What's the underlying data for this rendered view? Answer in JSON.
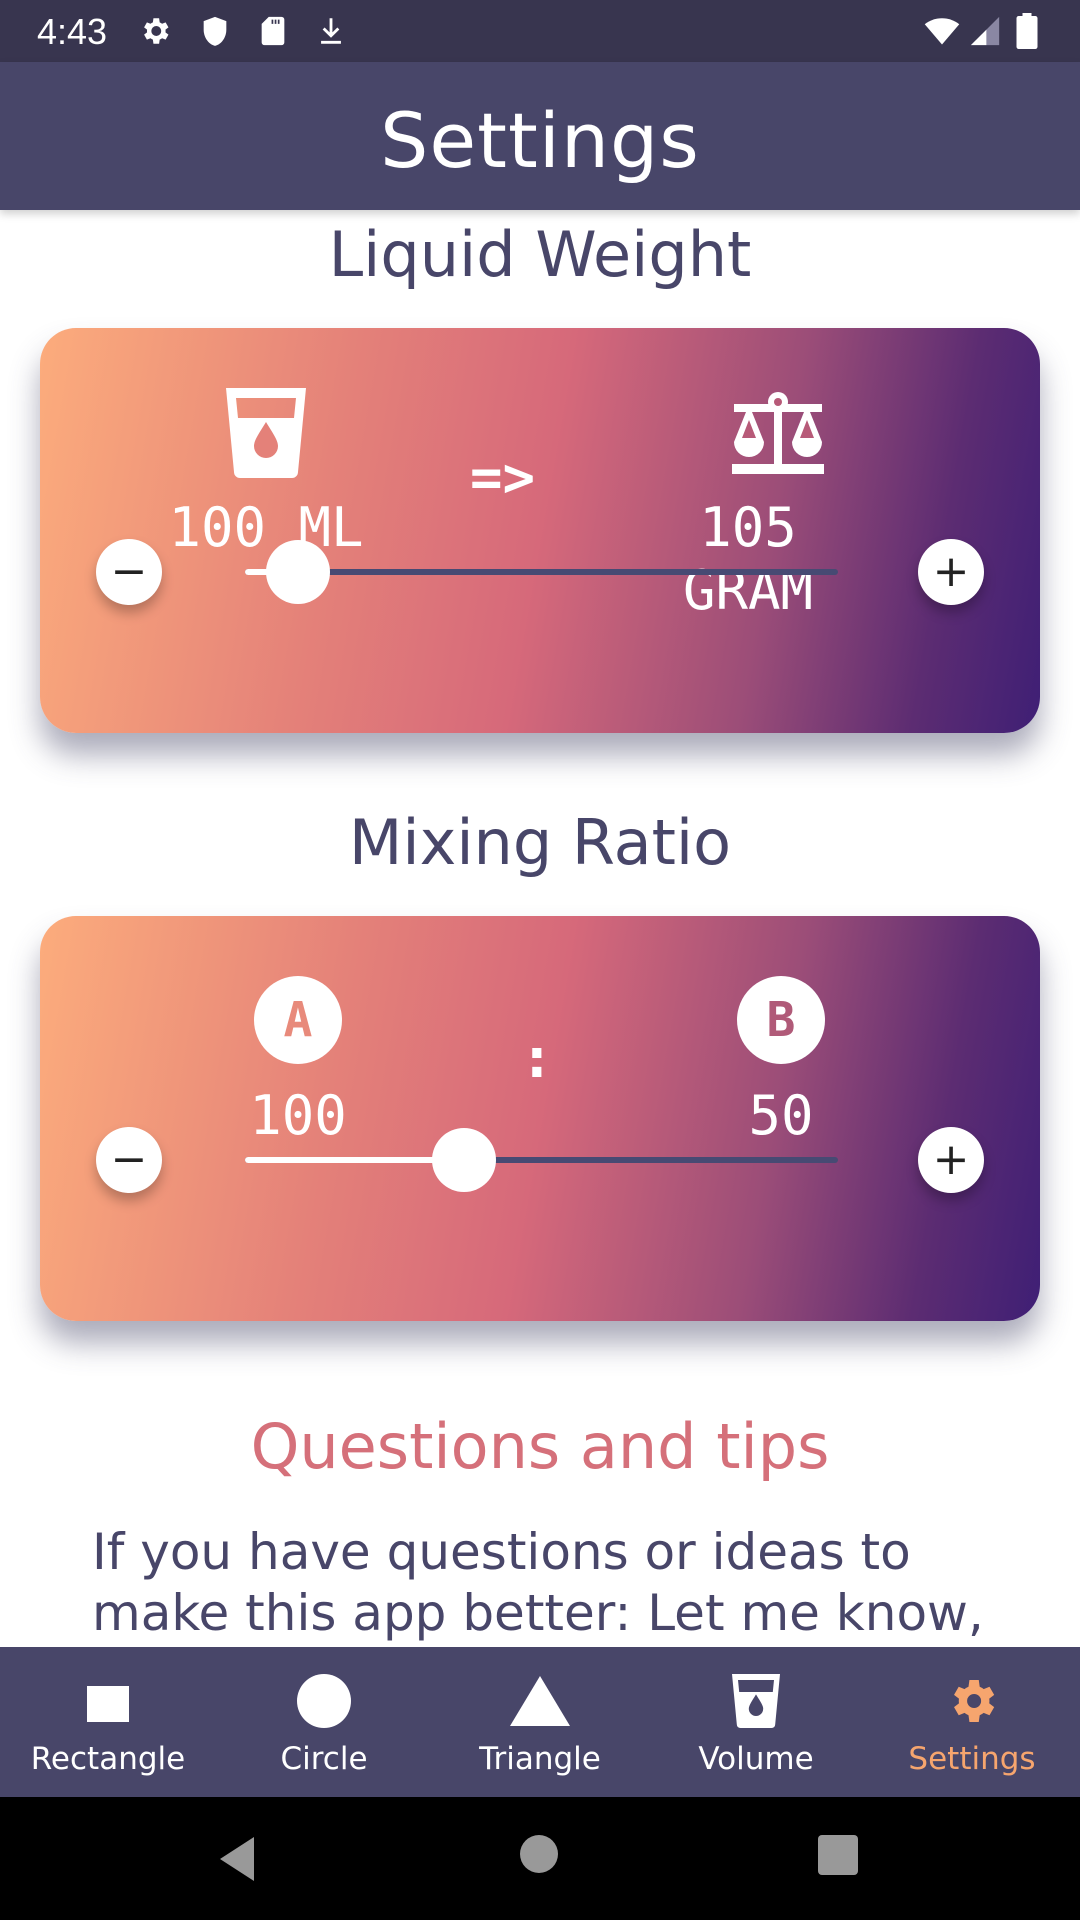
{
  "status_bar": {
    "time": "4:43",
    "left_icons": [
      "gear-icon",
      "shield-icon",
      "sd-card-icon",
      "download-icon"
    ],
    "right_icons": [
      "wifi-icon",
      "cell-signal-icon",
      "battery-icon"
    ]
  },
  "app_bar": {
    "title": "Settings"
  },
  "liquid_weight": {
    "title": "Liquid Weight",
    "from_icon": "glass-water-icon",
    "from_value": "100 ML",
    "arrow": "=>",
    "to_icon": "scale-icon",
    "to_value": "105 GRAM",
    "decrease_label": "−",
    "increase_label": "+",
    "slider_fraction": 0.09
  },
  "mixing_ratio": {
    "title": "Mixing Ratio",
    "a_letter": "A",
    "a_value": "100",
    "separator": ":",
    "b_letter": "B",
    "b_value": "50",
    "decrease_label": "−",
    "increase_label": "+",
    "slider_fraction": 0.37
  },
  "questions": {
    "title": "Questions and tips",
    "text": "If you have questions or ideas to make this app better: Let me know,"
  },
  "bottom_nav": {
    "items": [
      {
        "label": "Rectangle",
        "icon": "rectangle-icon",
        "active": false
      },
      {
        "label": "Circle",
        "icon": "circle-icon",
        "active": false
      },
      {
        "label": "Triangle",
        "icon": "triangle-icon",
        "active": false
      },
      {
        "label": "Volume",
        "icon": "glass-water-icon",
        "active": false
      },
      {
        "label": "Settings",
        "icon": "gear-icon",
        "active": true
      }
    ]
  },
  "colors": {
    "primary": "#484669",
    "status_bar": "#38354f",
    "accent": "#f6a56e",
    "tips_title": "#d5707a",
    "gradient_start": "#fcac7c",
    "gradient_mid": "#d6697a",
    "gradient_end": "#3f1f75"
  },
  "system_nav": {
    "buttons": [
      "back",
      "home",
      "recents"
    ]
  }
}
